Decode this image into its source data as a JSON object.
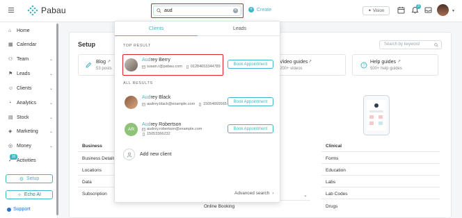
{
  "app": {
    "brand": "Pabau",
    "accent_color": "#3fb8c6",
    "highlight_color": "#e0202a"
  },
  "topbar": {
    "search_value": "aud",
    "create_label": "Create",
    "vision_label": "Vision",
    "notification_count": "3",
    "icons": [
      "hamburger-icon",
      "calendar-icon",
      "bell-icon",
      "inbox-icon"
    ]
  },
  "sidebar": {
    "items": [
      {
        "label": "Home",
        "icon": "home-icon",
        "has_chevron": false
      },
      {
        "label": "Calendar",
        "icon": "calendar-icon",
        "has_chevron": false
      },
      {
        "label": "Team",
        "icon": "team-icon",
        "has_chevron": true
      },
      {
        "label": "Leads",
        "icon": "leads-icon",
        "has_chevron": true
      },
      {
        "label": "Clients",
        "icon": "clients-icon",
        "has_chevron": true
      },
      {
        "label": "Analytics",
        "icon": "analytics-icon",
        "has_chevron": true
      },
      {
        "label": "Stock",
        "icon": "stock-icon",
        "has_chevron": true
      },
      {
        "label": "Marketing",
        "icon": "marketing-icon",
        "has_chevron": true
      },
      {
        "label": "Money",
        "icon": "money-icon",
        "has_chevron": true
      },
      {
        "label": "Activities",
        "icon": "activities-icon",
        "has_chevron": false
      }
    ],
    "activities_badge": "16",
    "setup_label": "Setup",
    "echo_label": "Echo AI",
    "support_label": "Support"
  },
  "main": {
    "title": "Setup",
    "search_placeholder": "Search by keyword",
    "cards": [
      {
        "title": "Blog",
        "subtitle": "53 posts"
      },
      {
        "title": "Video guides",
        "subtitle": "200+ videos"
      },
      {
        "title": "Help guides",
        "subtitle": "500+ help guides"
      }
    ],
    "business": {
      "heading": "Business",
      "links": [
        "Business Details",
        "Locations",
        "Data",
        "Subscription"
      ]
    },
    "middle_links": [
      "Online Booking"
    ],
    "clinical": {
      "heading": "Clinical",
      "links": [
        "Forms",
        "Education",
        "Labs",
        "Lab Codes",
        "Drugs"
      ]
    }
  },
  "dropdown": {
    "tabs": [
      {
        "label": "Clients",
        "active": true
      },
      {
        "label": "Leads",
        "active": false
      }
    ],
    "top_result_label": "TOP RESULT",
    "all_results_label": "ALL RESULTS",
    "book_label": "Book Appointment",
    "top_result": {
      "name_match": "Aud",
      "name_rest": "rey Berry",
      "email": "susan.r@pabau.com",
      "phone": "01284653344789"
    },
    "results": [
      {
        "name_match": "Aud",
        "name_rest": "rey Black",
        "email": "audrey.black@example.com",
        "phone": "15054665565",
        "avatar_type": "photo"
      },
      {
        "name_match": "Aud",
        "name_rest": "rey Robertson",
        "email": "audrey.robertson@example.com",
        "phone": "15053366232",
        "avatar_type": "initials",
        "initials": "AR"
      }
    ],
    "add_new_label": "Add new client",
    "advanced_search_label": "Advanced search"
  }
}
